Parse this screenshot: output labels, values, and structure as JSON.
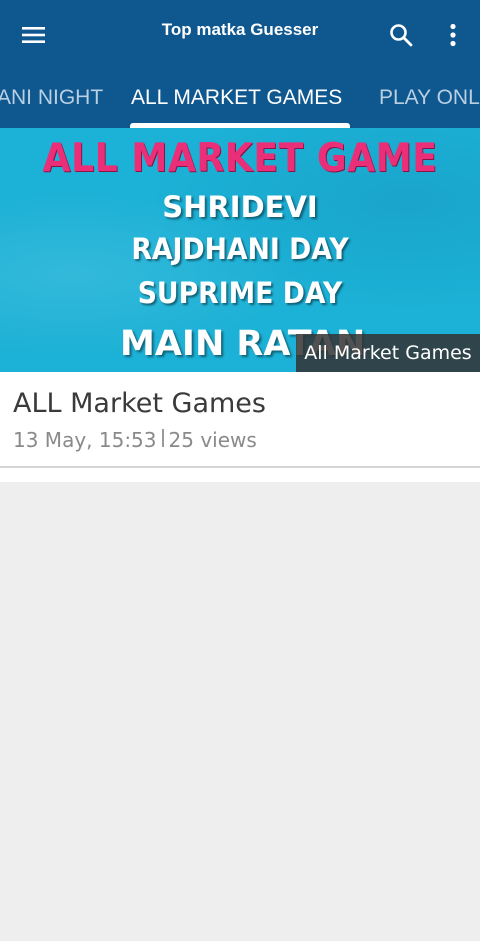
{
  "app": {
    "title": "Top matka Guesser",
    "brand_color": "#0f578f"
  },
  "toolbar": {
    "menu_icon": "hamburger-menu-icon",
    "search_icon": "search-icon",
    "more_icon": "more-vertical-icon"
  },
  "tabs": [
    {
      "label": "ANI NIGHT",
      "active": false
    },
    {
      "label": "ALL MARKET GAMES",
      "active": true
    },
    {
      "label": "PLAY ONL",
      "active": false
    }
  ],
  "banner": {
    "headline": "ALL MARKET GAME",
    "lines": [
      "SHRIDEVI",
      "RAJDHANI DAY",
      "SUPRIME DAY",
      "MAIN RATAN"
    ],
    "caption": "All Market Games",
    "headline_color": "#ea2f78",
    "background_color": "#1cb1d6"
  },
  "post": {
    "title": "ALL Market Games",
    "date": "13 May, 15:53",
    "views": "25 views"
  }
}
